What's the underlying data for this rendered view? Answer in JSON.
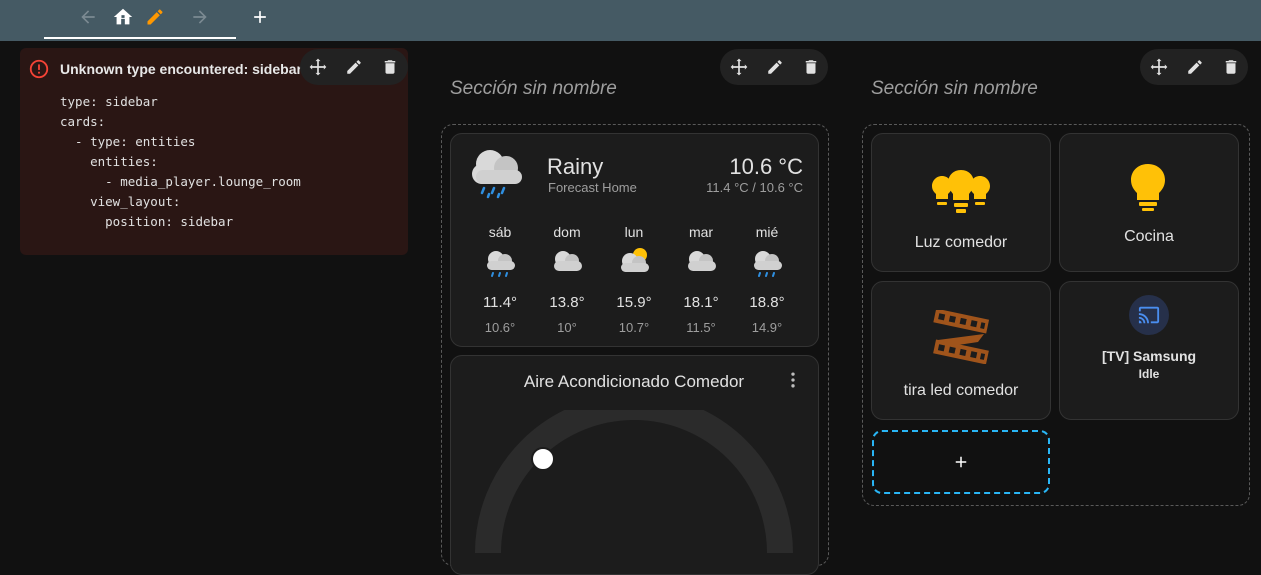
{
  "colors": {
    "topbar": "#455a64",
    "accent_orange": "#ff9800",
    "bulb_amber": "#ffc107",
    "led_brown": "#a0541b",
    "error_red": "#f44336",
    "add_border": "#29b6f6"
  },
  "toolbar": {
    "icons": [
      "arrow-left-icon",
      "home-icon",
      "pencil-icon",
      "arrow-right-icon",
      "plus-icon"
    ]
  },
  "error_card": {
    "title": "Unknown type encountered: sidebar",
    "yaml": "type: sidebar\ncards:\n  - type: entities\n    entities:\n      - media_player.lounge_room\n    view_layout:\n      position: sidebar"
  },
  "sections": [
    {
      "title": "Sección sin nombre"
    },
    {
      "title": "Sección sin nombre"
    }
  ],
  "weather": {
    "condition": "Rainy",
    "name": "Forecast Home",
    "temperature": "10.6 °C",
    "subtitle": "11.4 °C / 10.6 °C",
    "forecast": [
      {
        "day": "sáb",
        "high": "11.4°",
        "low": "10.6°",
        "icon": "rainy-icon"
      },
      {
        "day": "dom",
        "high": "13.8°",
        "low": "10°",
        "icon": "cloudy-icon"
      },
      {
        "day": "lun",
        "high": "15.9°",
        "low": "10.7°",
        "icon": "partly-cloudy-icon"
      },
      {
        "day": "mar",
        "high": "18.1°",
        "low": "11.5°",
        "icon": "cloudy-icon"
      },
      {
        "day": "mié",
        "high": "18.8°",
        "low": "14.9°",
        "icon": "rainy-icon"
      }
    ]
  },
  "thermostat": {
    "title": "Aire Acondicionado Comedor"
  },
  "tiles": [
    {
      "label": "Luz comedor",
      "icon": "ceiling-lights-icon"
    },
    {
      "label": "Cocina",
      "icon": "lightbulb-icon"
    },
    {
      "label": "tira led comedor",
      "icon": "led-strip-icon"
    },
    {
      "label": "[TV] Samsung",
      "state": "Idle",
      "icon": "cast-icon"
    }
  ]
}
